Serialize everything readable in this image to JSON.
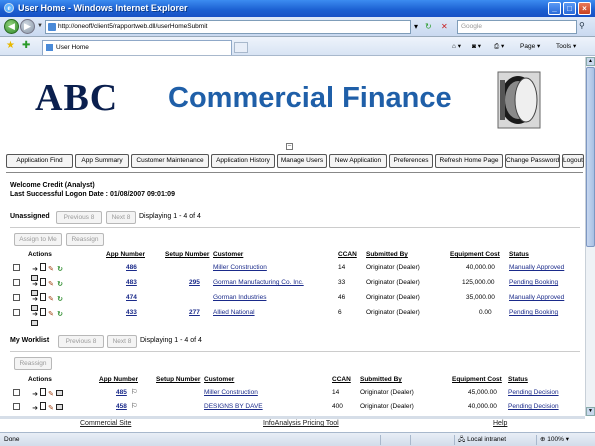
{
  "window": {
    "title": "User Home - Windows Internet Explorer"
  },
  "address_bar": {
    "url": "http://oneoff/client5/rapportweb.dll/userHomeSubmit",
    "search_placeholder": "Google"
  },
  "tab": {
    "label": "User Home"
  },
  "toolbar": {
    "page": "Page ▾",
    "tools": "Tools ▾"
  },
  "header": {
    "logo": "ABC",
    "brand": "Commercial Finance"
  },
  "nav_buttons": [
    "Application Find",
    "App Summary",
    "Customer Maintenance",
    "Application History",
    "Manage Users",
    "New Application",
    "Preferences",
    "Refresh Home Page",
    "Change Password",
    "Logout"
  ],
  "welcome": {
    "line1": "Welcome Credit (Analyst)",
    "line2": "Last Successful Logon Date : 01/08/2007 09:01:09"
  },
  "unassigned": {
    "label": "Unassigned",
    "previous": "Previous 8",
    "next": "Next 8",
    "displaying": "Displaying 1 - 4 of 4",
    "assign_to_me": "Assign to Me",
    "reassign": "Reassign",
    "columns": {
      "actions": "Actions",
      "app_number": "App Number",
      "setup_number": "Setup Number",
      "customer": "Customer",
      "ccan": "CCAN",
      "submitted_by": "Submitted By",
      "equipment_cost": "Equipment Cost",
      "status": "Status"
    },
    "rows": [
      {
        "app": "486",
        "setup": "",
        "customer": "Miller Construction",
        "ccan": "14",
        "submitted_by": "Originator (Dealer)",
        "cost": "40,000.00",
        "status": "Manually Approved"
      },
      {
        "app": "483",
        "setup": "295",
        "customer": "Gorman Manufacturing Co. Inc.",
        "ccan": "33",
        "submitted_by": "Originator (Dealer)",
        "cost": "125,000.00",
        "status": "Pending Booking"
      },
      {
        "app": "474",
        "setup": "",
        "customer": "Gorman Industries",
        "ccan": "46",
        "submitted_by": "Originator (Dealer)",
        "cost": "35,000.00",
        "status": "Manually Approved"
      },
      {
        "app": "433",
        "setup": "277",
        "customer": "Allied National",
        "ccan": "6",
        "submitted_by": "Originator (Dealer)",
        "cost": "0.00",
        "status": "Pending Booking"
      }
    ]
  },
  "worklist": {
    "label": "My Worklist",
    "previous": "Previous 8",
    "next": "Next 8",
    "displaying": "Displaying 1 - 4 of 4",
    "reassign": "Reassign",
    "rows": [
      {
        "app": "485",
        "setup": "",
        "customer": "Miller Construction",
        "ccan": "14",
        "submitted_by": "Originator (Dealer)",
        "cost": "45,000.00",
        "status": "Pending Decision"
      },
      {
        "app": "458",
        "setup": "",
        "customer": "DESIGNS BY DAVE",
        "ccan": "400",
        "submitted_by": "Originator (Dealer)",
        "cost": "40,000.00",
        "status": "Pending Decision"
      }
    ]
  },
  "footer": {
    "commercial_site": "Commercial Site",
    "pricing_tool": "InfoAnalysis Pricing Tool",
    "help": "Help"
  },
  "status_bar": {
    "done": "Done",
    "zone": "Local intranet",
    "zoom": "100%"
  },
  "icons": [
    "ie-logo-icon",
    "back-arrow-icon",
    "forward-arrow-icon",
    "refresh-icon",
    "stop-icon",
    "search-icon",
    "favorites-star-icon",
    "add-favorites-icon",
    "home-icon",
    "feeds-icon",
    "print-icon",
    "vault-door-icon"
  ]
}
